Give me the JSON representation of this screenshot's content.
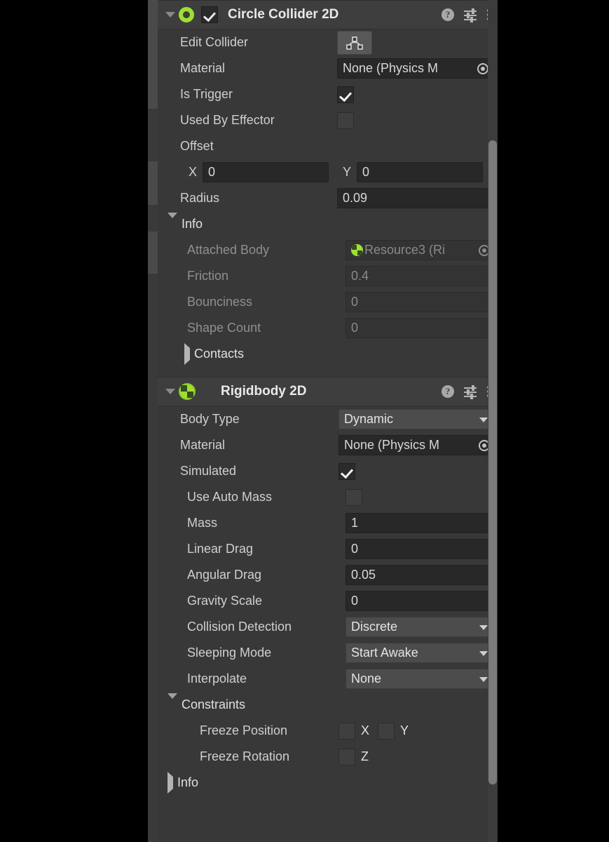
{
  "panel": {
    "accent_green": "#9fe033",
    "bg": "#383838",
    "header_bg": "#3e3e3e",
    "field_bg": "#282828",
    "dropdown_bg": "#4c4c4c"
  },
  "components": [
    {
      "title": "Circle Collider 2D",
      "icon": "circle-collider-2d-icon",
      "enabled": true,
      "expanded": true,
      "header_buttons": [
        "help-icon",
        "preset-icon",
        "kebab-menu-icon"
      ],
      "rows": {
        "edit_collider_label": "Edit Collider",
        "edit_collider_icon": "polygon-edit-icon",
        "material_label": "Material",
        "material_value": "None (Physics M",
        "is_trigger_label": "Is Trigger",
        "is_trigger_value": true,
        "used_by_effector_label": "Used By Effector",
        "used_by_effector_value": false,
        "offset_label": "Offset",
        "offset_x_axis": "X",
        "offset_x_value": "0",
        "offset_y_axis": "Y",
        "offset_y_value": "0",
        "radius_label": "Radius",
        "radius_value": "0.09"
      },
      "info": {
        "label": "Info",
        "expanded": true,
        "attached_body_label": "Attached Body",
        "attached_body_value": "Resource3 (Ri",
        "friction_label": "Friction",
        "friction_value": "0.4",
        "bounciness_label": "Bounciness",
        "bounciness_value": "0",
        "shape_count_label": "Shape Count",
        "shape_count_value": "0",
        "contacts_label": "Contacts",
        "contacts_expanded": false
      }
    },
    {
      "title": "Rigidbody 2D",
      "icon": "rigidbody-2d-icon",
      "enabled": null,
      "expanded": true,
      "header_buttons": [
        "help-icon",
        "preset-icon",
        "kebab-menu-icon"
      ],
      "rows": {
        "body_type_label": "Body Type",
        "body_type_value": "Dynamic",
        "material_label": "Material",
        "material_value": "None (Physics M",
        "simulated_label": "Simulated",
        "simulated_value": true,
        "use_auto_mass_label": "Use Auto Mass",
        "use_auto_mass_value": false,
        "mass_label": "Mass",
        "mass_value": "1",
        "linear_drag_label": "Linear Drag",
        "linear_drag_value": "0",
        "angular_drag_label": "Angular Drag",
        "angular_drag_value": "0.05",
        "gravity_scale_label": "Gravity Scale",
        "gravity_scale_value": "0",
        "collision_detection_label": "Collision Detection",
        "collision_detection_value": "Discrete",
        "sleeping_mode_label": "Sleeping Mode",
        "sleeping_mode_value": "Start Awake",
        "interpolate_label": "Interpolate",
        "interpolate_value": "None"
      },
      "constraints": {
        "label": "Constraints",
        "expanded": true,
        "freeze_position_label": "Freeze Position",
        "freeze_position_x_axis": "X",
        "freeze_position_x_value": false,
        "freeze_position_y_axis": "Y",
        "freeze_position_y_value": false,
        "freeze_rotation_label": "Freeze Rotation",
        "freeze_rotation_z_axis": "Z",
        "freeze_rotation_z_value": false
      },
      "info": {
        "label": "Info",
        "expanded": false
      }
    }
  ],
  "scrollbar": {
    "present": true
  }
}
